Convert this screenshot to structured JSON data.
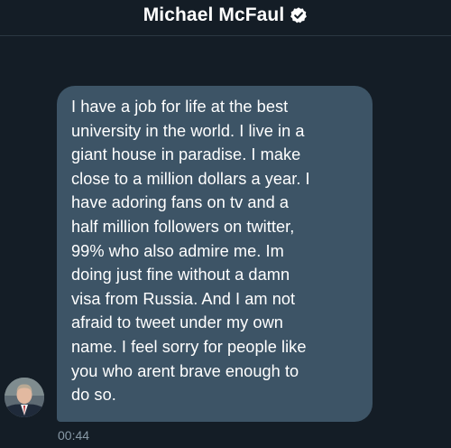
{
  "header": {
    "title": "Michael McFaul",
    "verified_icon": "verified-badge-icon"
  },
  "message": {
    "text": "I have a job for life at the best\nuniversity in the world. I live in a\ngiant house in paradise. I make\nclose to a million dollars a year. I\nhave adoring fans on tv and a\nhalf million followers on twitter,\n99% who also admire me.  Im\ndoing just fine without a damn\nvisa from Russia.  And I am not\nafraid to tweet under my own\nname.  I feel sorry for people like\nyou who arent brave enough to\ndo so.",
    "timestamp": "00:44"
  },
  "colors": {
    "background": "#141d26",
    "bubble": "#3d5466",
    "timestamp": "#8899a6"
  }
}
